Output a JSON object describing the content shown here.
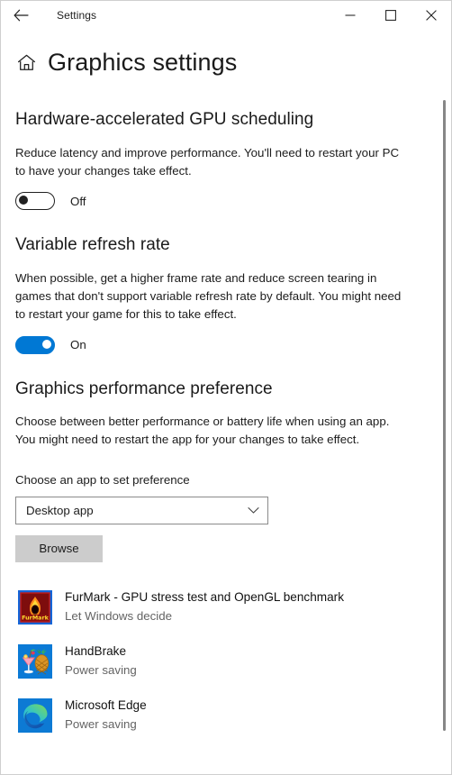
{
  "titlebar": {
    "back_icon": "back-arrow-icon",
    "title": "Settings",
    "minimize_icon": "minimize-icon",
    "maximize_icon": "maximize-icon",
    "close_icon": "close-icon"
  },
  "header": {
    "home_icon": "home-icon",
    "title": "Graphics settings"
  },
  "sections": {
    "gpu_scheduling": {
      "heading": "Hardware-accelerated GPU scheduling",
      "description": "Reduce latency and improve performance. You'll need to restart your PC to have your changes take effect.",
      "toggle_state": "Off"
    },
    "refresh_rate": {
      "heading": "Variable refresh rate",
      "description": "When possible, get a higher frame rate and reduce screen tearing in games that don't support variable refresh rate by default. You might need to restart your game for this to take effect.",
      "toggle_state": "On"
    },
    "performance_preference": {
      "heading": "Graphics performance preference",
      "description": "Choose between better performance or battery life when using an app. You might need to restart the app for your changes to take effect.",
      "field_label": "Choose an app to set preference",
      "dropdown_value": "Desktop app",
      "dropdown_icon": "chevron-down-icon",
      "browse_label": "Browse"
    }
  },
  "apps": [
    {
      "name": "FurMark - GPU stress test and OpenGL benchmark",
      "preference": "Let Windows decide",
      "icon": "furmark-icon"
    },
    {
      "name": "HandBrake",
      "preference": "Power saving",
      "icon": "handbrake-icon"
    },
    {
      "name": "Microsoft Edge",
      "preference": "Power saving",
      "icon": "microsoft-edge-icon"
    }
  ],
  "colors": {
    "accent": "#0078d4",
    "browse_button": "#cccccc",
    "secondary_text": "#646464"
  },
  "scrollbar": {
    "name": "vertical-scrollbar"
  }
}
